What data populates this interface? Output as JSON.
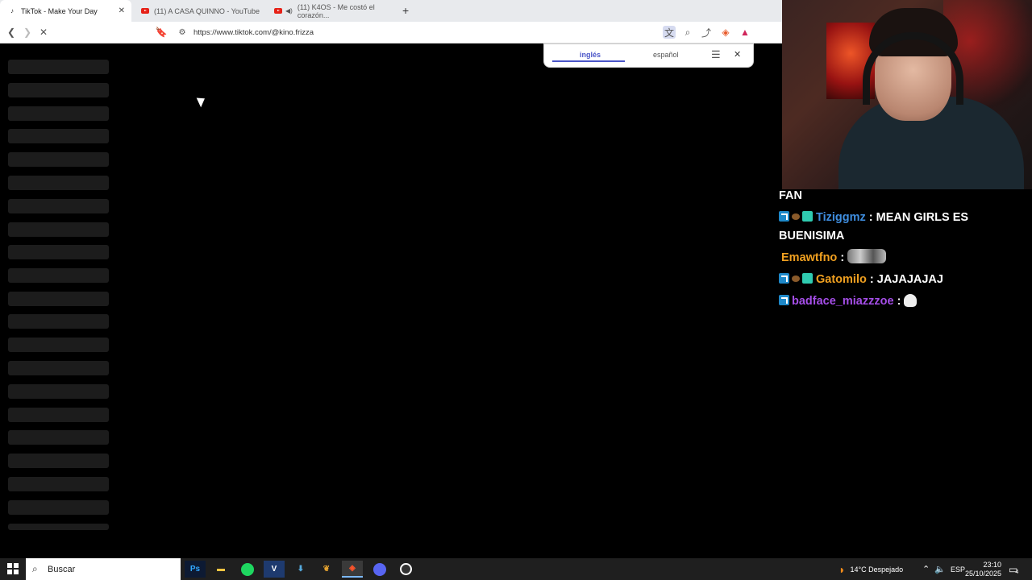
{
  "browser": {
    "tabs": [
      {
        "label": "TikTok - Make Your Day",
        "active": true
      },
      {
        "label": "(11) A CASA QUINNO - YouTube",
        "active": false
      },
      {
        "label": "(11) K4OS - Me costó el corazón...",
        "active": false
      }
    ],
    "url": "https://www.tiktok.com/@kino.frizza"
  },
  "translate_popup": {
    "tab_source": "inglés",
    "tab_target": "español"
  },
  "chat": {
    "partial_top": "FAN",
    "messages": [
      {
        "user": "Tiziggmz",
        "text": "MEAN GIRLS ES BUENISIMA",
        "color": "#3f8ee0",
        "badges": [
          "prime",
          "ball",
          "sub"
        ]
      },
      {
        "user": "Emawtfno",
        "text": "",
        "color": "#f0a020",
        "badges": [],
        "emote": true
      },
      {
        "user": "Gatomilo",
        "text": "JAJAJAJAJ",
        "color": "#f0a020",
        "badges": [
          "prime",
          "ball",
          "sub"
        ]
      },
      {
        "user": "badface_miazzzoe",
        "text": "",
        "color": "#a54ee8",
        "badges": [
          "prime"
        ],
        "skull": true
      }
    ],
    "separator": ":"
  },
  "taskbar": {
    "search_label": "Buscar",
    "weather": "14°C  Despejado",
    "language": "ESP",
    "time": "23:10",
    "date": "25/10/2025",
    "notifications": "4"
  }
}
